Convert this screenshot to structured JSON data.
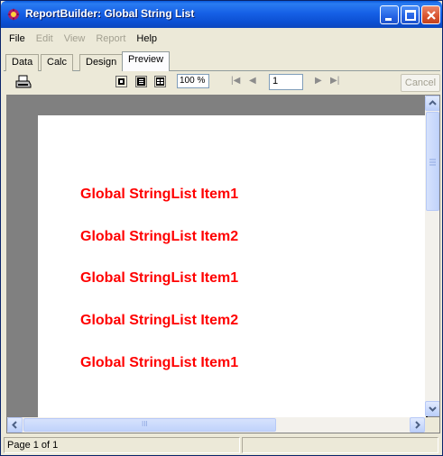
{
  "window": {
    "title": "ReportBuilder: Global String List"
  },
  "menu": [
    {
      "label": "File",
      "enabled": true
    },
    {
      "label": "Edit",
      "enabled": false
    },
    {
      "label": "View",
      "enabled": false
    },
    {
      "label": "Report",
      "enabled": false
    },
    {
      "label": "Help",
      "enabled": true
    }
  ],
  "tabs": [
    "Data",
    "Calc",
    "Design",
    "Preview"
  ],
  "active_tab": "Preview",
  "toolbar": {
    "zoom": "100 %",
    "page_number": "1",
    "cancel_label": "Cancel"
  },
  "report_lines": [
    "Global StringList Item1",
    "Global StringList Item2",
    "Global StringList Item1",
    "Global StringList Item2",
    "Global StringList Item1"
  ],
  "scrollbar": {
    "grip": "III"
  },
  "status": {
    "page_info": "Page 1 of 1"
  },
  "colors": {
    "report_text": "#ff0000",
    "titlebar": "#0b54e0"
  }
}
